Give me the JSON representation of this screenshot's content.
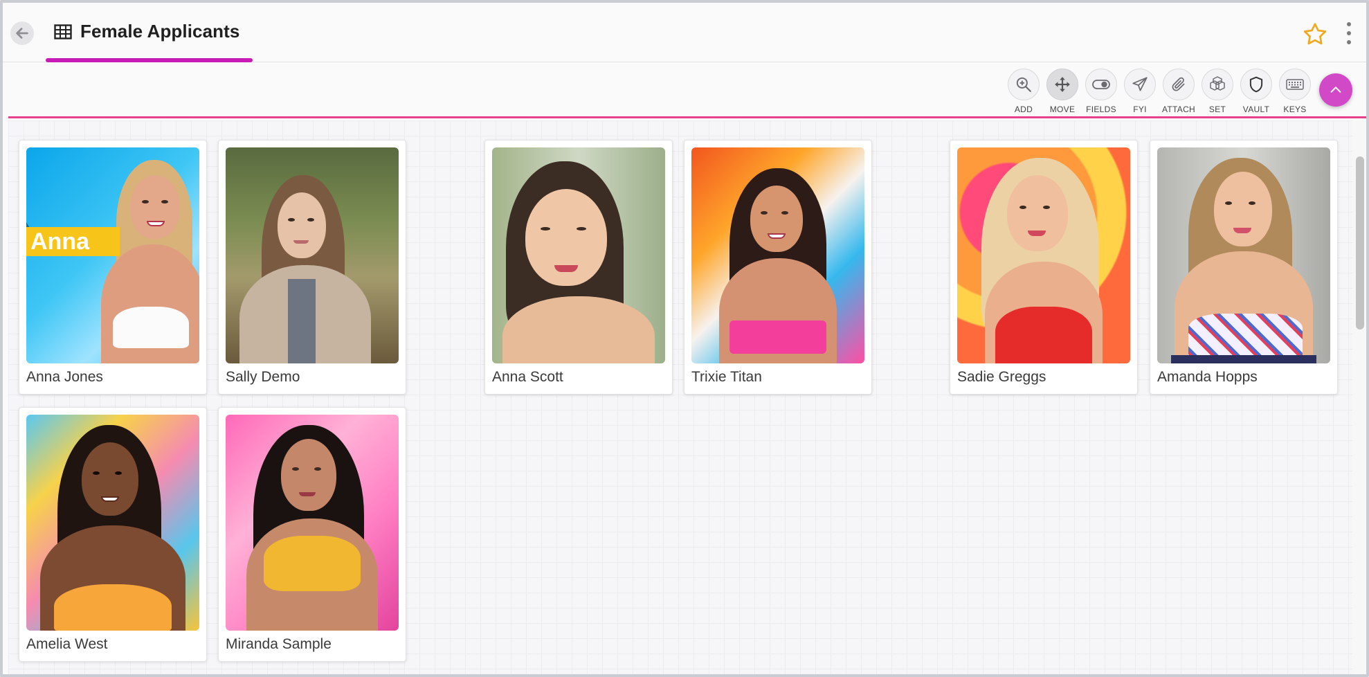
{
  "header": {
    "title": "Female Applicants"
  },
  "toolbar": {
    "tools": [
      {
        "label": "ADD",
        "icon": "zoom-in-icon"
      },
      {
        "label": "MOVE",
        "icon": "move-icon",
        "active": true
      },
      {
        "label": "FIELDS",
        "icon": "toggle-icon"
      },
      {
        "label": "FYI",
        "icon": "paper-plane-icon"
      },
      {
        "label": "ATTACH",
        "icon": "paperclip-icon"
      },
      {
        "label": "SET",
        "icon": "boxes-icon"
      },
      {
        "label": "VAULT",
        "icon": "shield-icon"
      },
      {
        "label": "KEYS",
        "icon": "keyboard-icon"
      }
    ]
  },
  "cards": [
    {
      "name": "Anna Jones",
      "photo_tag": "Anna"
    },
    {
      "name": "Sally Demo"
    },
    {
      "name": "Anna Scott"
    },
    {
      "name": "Trixie Titan"
    },
    {
      "name": "Sadie Greggs"
    },
    {
      "name": "Amanda Hopps"
    },
    {
      "name": "Amelia West"
    },
    {
      "name": "Miranda Sample"
    }
  ],
  "colors": {
    "accent": "#c81bb6",
    "toolbar_line": "#e8408a",
    "fab": "#d249c7",
    "star": "#f0a81e"
  }
}
